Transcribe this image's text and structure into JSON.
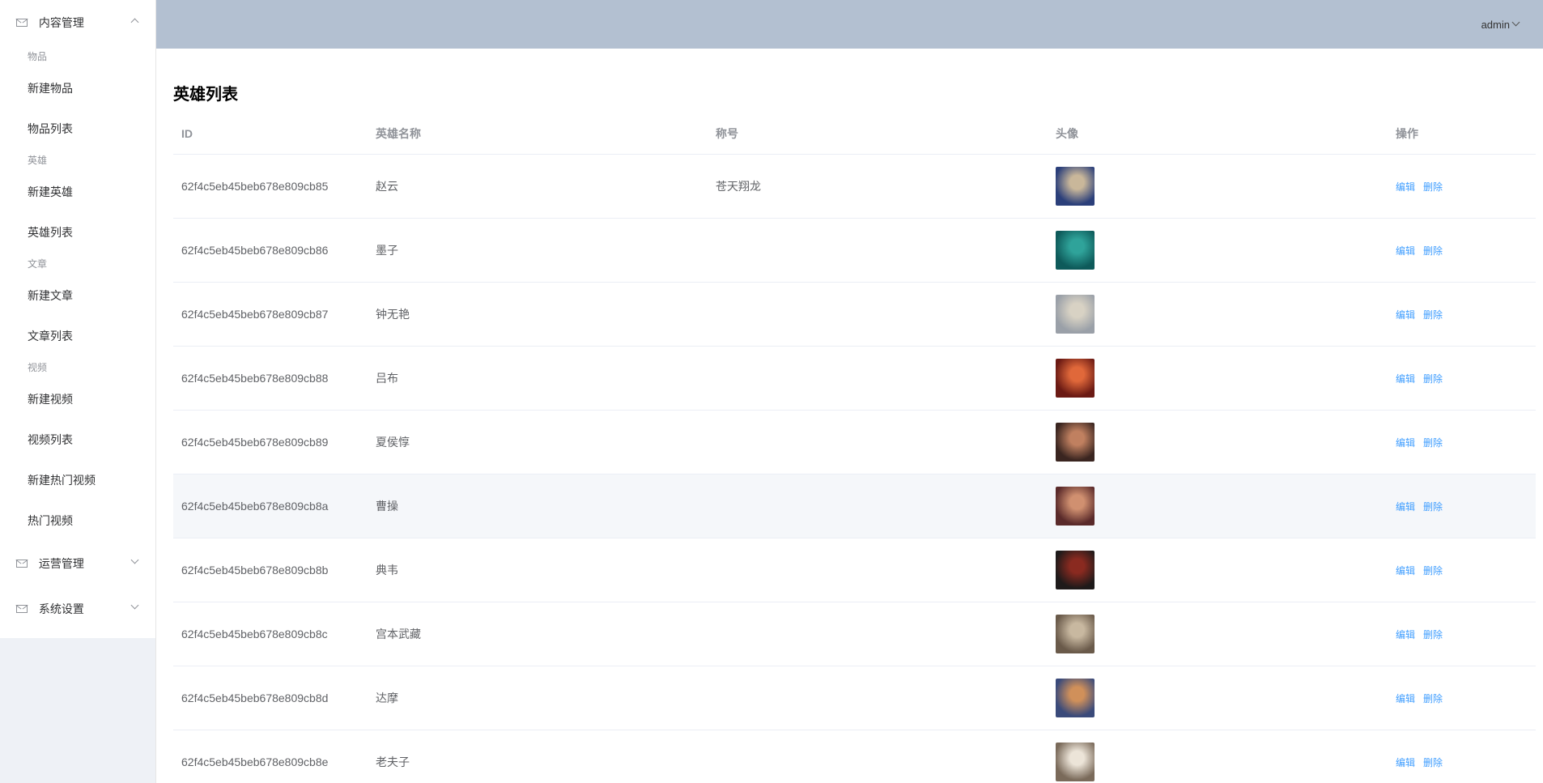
{
  "sidebar": {
    "menus": [
      {
        "title": "内容管理",
        "expanded": true,
        "groups": [
          {
            "title": "物品",
            "items": [
              "新建物品",
              "物品列表"
            ]
          },
          {
            "title": "英雄",
            "items": [
              "新建英雄",
              "英雄列表"
            ]
          },
          {
            "title": "文章",
            "items": [
              "新建文章",
              "文章列表"
            ]
          },
          {
            "title": "视频",
            "items": [
              "新建视频",
              "视频列表",
              "新建热门视频",
              "热门视频"
            ]
          }
        ]
      },
      {
        "title": "运营管理",
        "expanded": false
      },
      {
        "title": "系统设置",
        "expanded": false
      }
    ]
  },
  "header": {
    "user": "admin"
  },
  "page": {
    "title": "英雄列表"
  },
  "table": {
    "columns": [
      "ID",
      "英雄名称",
      "称号",
      "头像",
      "操作"
    ],
    "edit_label": "编辑",
    "delete_label": "删除",
    "rows": [
      {
        "id": "62f4c5eb45beb678e809cb85",
        "name": "赵云",
        "title": "苍天翔龙",
        "avatar_colors": [
          "#2b3f7a",
          "#c9b79a"
        ]
      },
      {
        "id": "62f4c5eb45beb678e809cb86",
        "name": "墨子",
        "title": "",
        "avatar_colors": [
          "#0e5a5a",
          "#2fa39a"
        ]
      },
      {
        "id": "62f4c5eb45beb678e809cb87",
        "name": "钟无艳",
        "title": "",
        "avatar_colors": [
          "#9aa0a8",
          "#d8d2c4"
        ]
      },
      {
        "id": "62f4c5eb45beb678e809cb88",
        "name": "吕布",
        "title": "",
        "avatar_colors": [
          "#6b1a14",
          "#e0683a"
        ]
      },
      {
        "id": "62f4c5eb45beb678e809cb89",
        "name": "夏侯惇",
        "title": "",
        "avatar_colors": [
          "#3a2520",
          "#c08060"
        ]
      },
      {
        "id": "62f4c5eb45beb678e809cb8a",
        "name": "曹操",
        "title": "",
        "avatar_colors": [
          "#5a2a2a",
          "#d09070"
        ]
      },
      {
        "id": "62f4c5eb45beb678e809cb8b",
        "name": "典韦",
        "title": "",
        "avatar_colors": [
          "#1e1a1a",
          "#8a2a20"
        ]
      },
      {
        "id": "62f4c5eb45beb678e809cb8c",
        "name": "宫本武藏",
        "title": "",
        "avatar_colors": [
          "#6a5a4a",
          "#c8b8a0"
        ]
      },
      {
        "id": "62f4c5eb45beb678e809cb8d",
        "name": "达摩",
        "title": "",
        "avatar_colors": [
          "#3a4a7a",
          "#d0905a"
        ]
      },
      {
        "id": "62f4c5eb45beb678e809cb8e",
        "name": "老夫子",
        "title": "",
        "avatar_colors": [
          "#7a6a5a",
          "#ece4d8"
        ]
      }
    ]
  }
}
